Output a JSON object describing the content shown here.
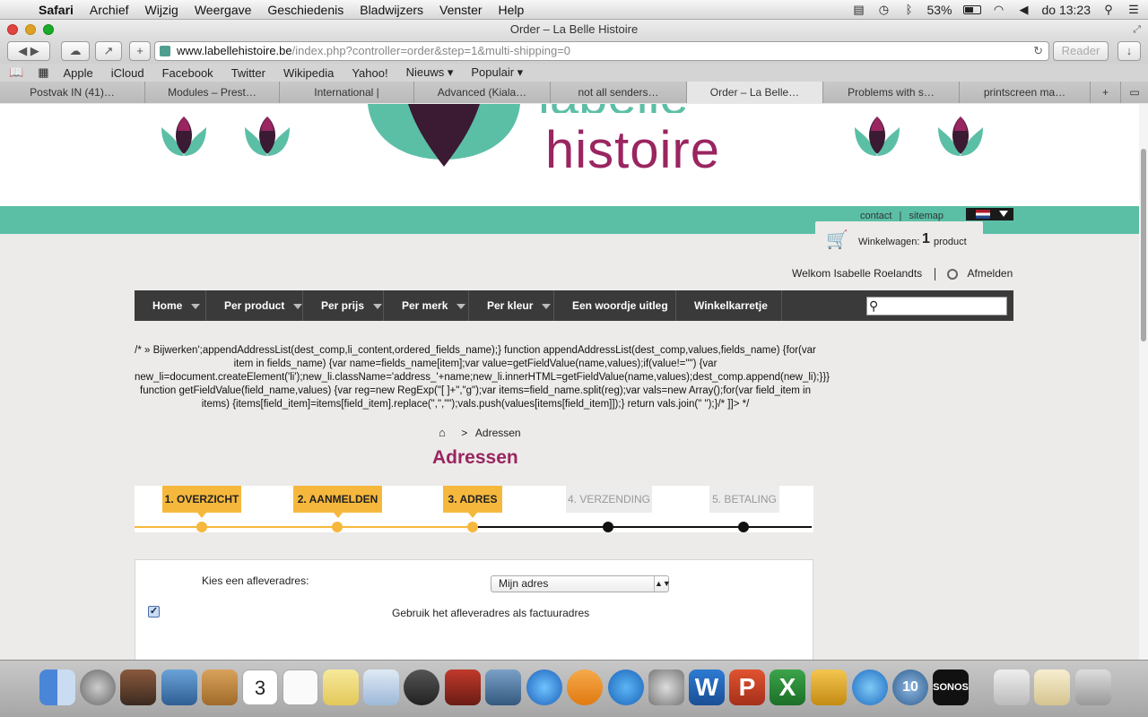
{
  "menubar": {
    "app": "Safari",
    "items": [
      "Archief",
      "Wijzig",
      "Weergave",
      "Geschiedenis",
      "Bladwijzers",
      "Venster",
      "Help"
    ],
    "battery": "53%",
    "clock": "do 13:23"
  },
  "window": {
    "title": "Order – La Belle Histoire"
  },
  "toolbar": {
    "url_host": "www.labellehistoire.be",
    "url_path": "/index.php?controller=order&step=1&multi-shipping=0",
    "reader_label": "Reader"
  },
  "bookmarks": [
    "Apple",
    "iCloud",
    "Facebook",
    "Twitter",
    "Wikipedia",
    "Yahoo!",
    "Nieuws ▾",
    "Populair ▾"
  ],
  "tabs": [
    {
      "label": "Postvak IN (41)…"
    },
    {
      "label": "Modules – Prest…"
    },
    {
      "label": "International |"
    },
    {
      "label": "Advanced (Kiala…"
    },
    {
      "label": "not all senders…"
    },
    {
      "label": "Order – La Belle…"
    },
    {
      "label": "Problems with s…"
    },
    {
      "label": "printscreen ma…"
    }
  ],
  "site": {
    "logo_text": "histoire",
    "toplinks": {
      "contact": "contact",
      "sitemap": "sitemap"
    },
    "cart": {
      "label": "Winkelwagen:",
      "count": "1",
      "unit": "product"
    },
    "welcome": "Welkom Isabelle Roelandts",
    "logout": "Afmelden",
    "nav": [
      {
        "label": "Home",
        "dropdown": true
      },
      {
        "label": "Per product",
        "dropdown": true
      },
      {
        "label": "Per prijs",
        "dropdown": true
      },
      {
        "label": "Per merk",
        "dropdown": true
      },
      {
        "label": "Per kleur",
        "dropdown": true
      },
      {
        "label": "Een woordje uitleg",
        "dropdown": false
      },
      {
        "label": "Winkelkarretje",
        "dropdown": false
      }
    ],
    "code_text": "/* » Bijwerken';appendAddressList(dest_comp,li_content,ordered_fields_name);} function appendAddressList(dest_comp,values,fields_name) {for(var item in fields_name) {var name=fields_name[item];var value=getFieldValue(name,values);if(value!=\"\") {var new_li=document.createElement('li');new_li.className='address_'+name;new_li.innerHTML=getFieldValue(name,values);dest_comp.append(new_li);}}} function getFieldValue(field_name,values) {var reg=new RegExp(\"[ ]+\",\"g\");var items=field_name.split(reg);var vals=new Array();for(var field_item in items) {items[field_item]=items[field_item].replace(\",\",\"\");vals.push(values[items[field_item]]);} return vals.join(\" \");}/* ]]> */",
    "breadcrumb": {
      "separator": ">",
      "current": "Adressen"
    },
    "heading": "Adressen",
    "steps": [
      {
        "label": "1. OVERZICHT",
        "state": "done"
      },
      {
        "label": "2. AANMELDEN",
        "state": "done"
      },
      {
        "label": "3. ADRES",
        "state": "done"
      },
      {
        "label": "4. VERZENDING",
        "state": "todo"
      },
      {
        "label": "5. BETALING",
        "state": "todo"
      }
    ],
    "form": {
      "delivery_label": "Kies een afleveradres:",
      "delivery_value": "Mijn adres",
      "invoice_checkbox_label": "Gebruik het afleveradres als factuuradres",
      "invoice_checked": true
    },
    "colors": {
      "accent": "#9a2560",
      "green": "#5bbfa6",
      "step_done": "#f6b83c",
      "nav": "#3a3a3a"
    }
  }
}
